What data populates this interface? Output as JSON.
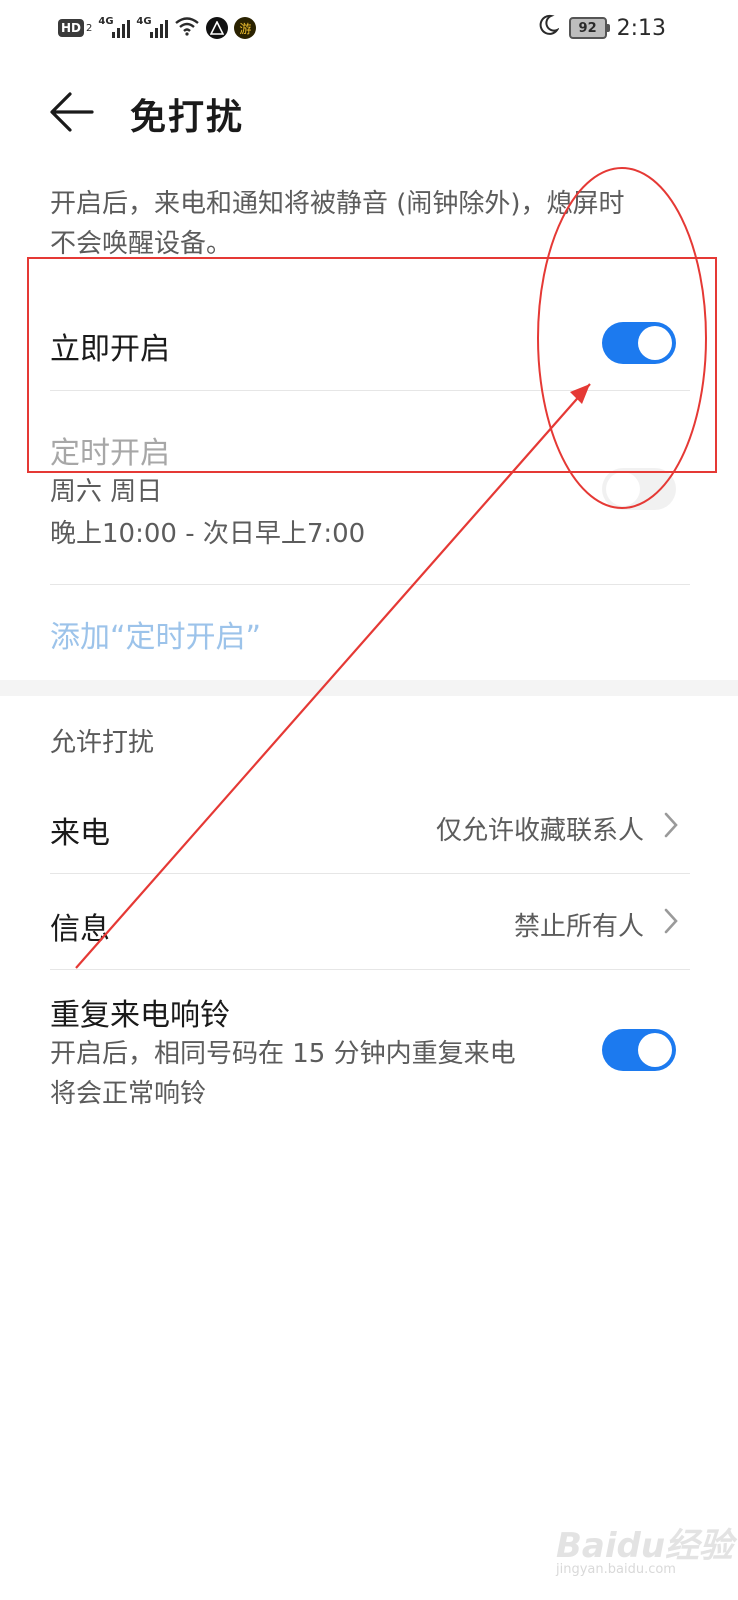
{
  "status_bar": {
    "hd": "HD",
    "sim_slot": "2",
    "net1": "4G",
    "net2": "4G",
    "badge_char": "游",
    "battery": "92",
    "time": "2:13",
    "icons": [
      "hd-icon",
      "signal-icon",
      "signal-icon",
      "wifi-icon",
      "app-icon",
      "app-icon",
      "moon-icon",
      "battery-icon"
    ]
  },
  "header": {
    "title": "免打扰",
    "back_icon": "arrow-left-icon"
  },
  "description": {
    "line1": "开启后，来电和通知将被静音 (闹钟除外)，熄屏时",
    "line2": "不会唤醒设备。"
  },
  "immediate": {
    "label": "立即开启",
    "enabled": true
  },
  "scheduled": {
    "label": "定时开启",
    "days": "周六 周日",
    "time_range": "晚上10:00 - 次日早上7:00",
    "enabled": false
  },
  "add_schedule": "添加“定时开启”",
  "allow_section": {
    "title": "允许打扰",
    "calls": {
      "label": "来电",
      "value": "仅允许收藏联系人"
    },
    "messages": {
      "label": "信息",
      "value": "禁止所有人"
    },
    "repeat_calls": {
      "label": "重复来电响铃",
      "desc_line1": "开启后，相同号码在 15 分钟内重复来电",
      "desc_line2": "将会正常响铃",
      "enabled": true
    }
  },
  "watermark": {
    "main": "Baidu经验",
    "sub": "jingyan.baidu.com"
  },
  "colors": {
    "accent": "#1c7aef",
    "annotation": "#e53935",
    "link": "#9cc3ea"
  }
}
